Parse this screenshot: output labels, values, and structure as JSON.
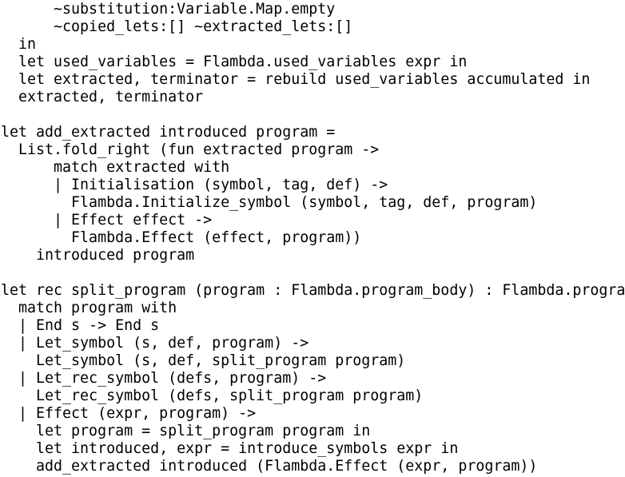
{
  "code": {
    "lines": [
      "      ~substitution:Variable.Map.empty",
      "      ~copied_lets:[] ~extracted_lets:[]",
      "  in",
      "  let used_variables = Flambda.used_variables expr in",
      "  let extracted, terminator = rebuild used_variables accumulated in",
      "  extracted, terminator",
      "",
      "let add_extracted introduced program =",
      "  List.fold_right (fun extracted program ->",
      "      match extracted with",
      "      | Initialisation (symbol, tag, def) ->",
      "        Flambda.Initialize_symbol (symbol, tag, def, program)",
      "      | Effect effect ->",
      "        Flambda.Effect (effect, program))",
      "    introduced program",
      "",
      "let rec split_program (program : Flambda.program_body) : Flambda.progra",
      "  match program with",
      "  | End s -> End s",
      "  | Let_symbol (s, def, program) ->",
      "    Let_symbol (s, def, split_program program)",
      "  | Let_rec_symbol (defs, program) ->",
      "    Let_rec_symbol (defs, split_program program)",
      "  | Effect (expr, program) ->",
      "    let program = split_program program in",
      "    let introduced, expr = introduce_symbols expr in",
      "    add_extracted introduced (Flambda.Effect (expr, program))"
    ]
  }
}
